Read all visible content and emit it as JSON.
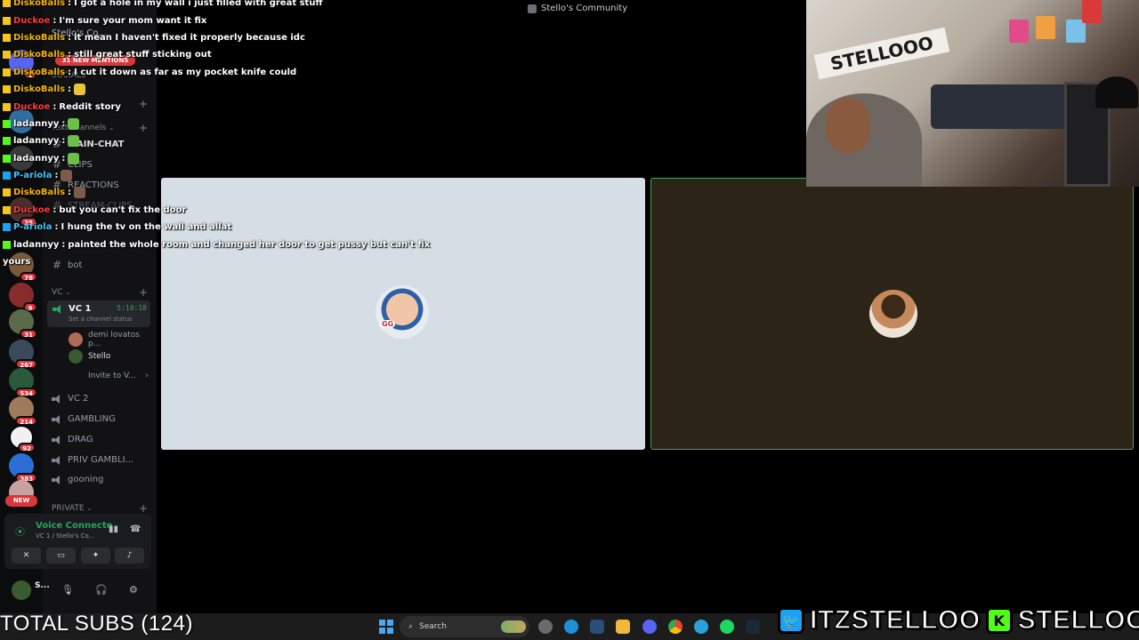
{
  "window": {
    "title": "Stello's Community"
  },
  "server_rail": {
    "badges": [
      "1",
      "25",
      "78",
      "9",
      "31",
      "267",
      "534",
      "214",
      "92",
      "383"
    ],
    "new_label": "NEW"
  },
  "sidebar": {
    "mentions_pill": "31 NEW MENTIONS",
    "partial_server_name": "Stello's Co...",
    "categories": {
      "socials": "SOCIALS",
      "text": "Text channels",
      "vc": "VC",
      "private": "PRIVATE"
    },
    "text_channels": [
      "MAIN-CHAT",
      "CLIPS",
      "REACTIONS",
      "STREAM-CLIPS",
      "bot"
    ],
    "voice_channels": {
      "active": {
        "name": "VC 1",
        "timer": "5:18:18",
        "status": "Set a channel status"
      },
      "members": [
        "demi lovatos p...",
        "Stello"
      ],
      "invite": "Invite to V...",
      "others": [
        "VC 2",
        "GAMBLING",
        "DRAG",
        "PRIV GAMBLI...",
        "gooning"
      ]
    },
    "voice_panel": {
      "title": "Voice Connecte",
      "subtitle": "VC 1 / Stello's Co..."
    },
    "user": {
      "name": "S..."
    }
  },
  "chat": [
    {
      "user": "DiskoBalls",
      "color": "#f5b400",
      "platform": "tw",
      "text": "I got a hole in my wall i just filled with great stuff"
    },
    {
      "user": "Duckoe",
      "color": "#ff3b3b",
      "platform": "tw",
      "text": "I'm sure your mom want it fix"
    },
    {
      "user": "DiskoBalls",
      "color": "#f5b400",
      "platform": "tw",
      "text": "it mean I haven't fixed it properly because idc"
    },
    {
      "user": "DiskoBalls",
      "color": "#f5b400",
      "platform": "tw",
      "text": "still great stuff sticking out"
    },
    {
      "user": "DiskoBalls",
      "color": "#f5b400",
      "platform": "tw",
      "text": "I cut it down as far as my pocket knife could"
    },
    {
      "user": "DiskoBalls",
      "color": "#f5b400",
      "platform": "tw",
      "text": "",
      "emote": "bee"
    },
    {
      "user": "Duckoe",
      "color": "#ff3b3b",
      "platform": "tw",
      "text": "Reddit story"
    },
    {
      "user": "ladannyy",
      "color": "#ffffff",
      "platform": "kk",
      "text": "",
      "emote": "frog"
    },
    {
      "user": "ladannyy",
      "color": "#ffffff",
      "platform": "kk",
      "text": "",
      "emote": "frog"
    },
    {
      "user": "ladannyy",
      "color": "#ffffff",
      "platform": "kk",
      "text": "",
      "emote": "frog"
    },
    {
      "user": "P-ariola",
      "color": "#3ec6ff",
      "platform": "x",
      "text": "",
      "emote": "gear"
    },
    {
      "user": "DiskoBalls",
      "color": "#f5b400",
      "platform": "tw",
      "text": "",
      "emote": "gear"
    },
    {
      "user": "Duckoe",
      "color": "#ff3b3b",
      "platform": "tw",
      "text": "but you can't fix the door"
    },
    {
      "user": "P-ariola",
      "color": "#3ec6ff",
      "platform": "x",
      "text": "I hung the tv on the wall and allat"
    },
    {
      "user": "ladannyy",
      "color": "#ffffff",
      "platform": "kk",
      "text": "painted the whole room and changed her door to get pussy but can't fix"
    },
    {
      "user": "",
      "color": "#ffffff",
      "platform": "",
      "text": "yours"
    }
  ],
  "video": {
    "left_tag": "GG"
  },
  "webcam": {
    "banner_text": "STELLOOO"
  },
  "overlay": {
    "subs": "TOTAL SUBS (124)",
    "twitter_handle": "ITZSTELLOO",
    "kick_handle": "STELLOOO",
    "kick_letter": "K"
  },
  "taskbar": {
    "search_placeholder": "Search"
  }
}
